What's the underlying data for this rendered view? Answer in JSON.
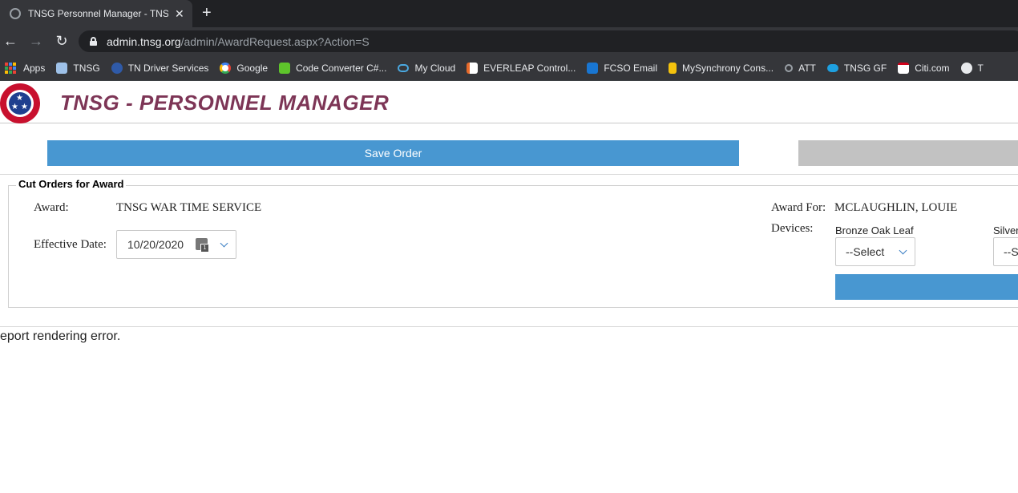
{
  "browser": {
    "tab_title": "TNSG Personnel Manager - TNSG",
    "url_host": "admin.tnsg.org",
    "url_path": "/admin/AwardRequest.aspx?Action=S",
    "bookmarks": [
      {
        "label": "Apps",
        "icon": "apps-grid-icon",
        "color": "#4285f4"
      },
      {
        "label": "TNSG",
        "icon": "page-icon",
        "color": "#9ec1e8"
      },
      {
        "label": "TN Driver Services",
        "icon": "tn-seal-icon",
        "color": "#2f5aa8"
      },
      {
        "label": "Google",
        "icon": "google-icon",
        "color": "#ffffff"
      },
      {
        "label": "Code Converter C#...",
        "icon": "code-converter-icon",
        "color": "#5ec42b"
      },
      {
        "label": "My Cloud",
        "icon": "cloud-icon",
        "color": "#4aa8e0"
      },
      {
        "label": "EVERLEAP Control...",
        "icon": "everleap-icon",
        "color": "#e86a2a"
      },
      {
        "label": "FCSO Email",
        "icon": "outlook-icon",
        "color": "#1976d2"
      },
      {
        "label": "MySynchrony Cons...",
        "icon": "synchrony-icon",
        "color": "#f4c20d"
      },
      {
        "label": "ATT",
        "icon": "key-icon",
        "color": "#9aa0a6"
      },
      {
        "label": "TNSG GF",
        "icon": "salesforce-icon",
        "color": "#1ea0e0"
      },
      {
        "label": "Citi.com",
        "icon": "citi-icon",
        "color": "#ffffff"
      },
      {
        "label": "T",
        "icon": "globe-icon",
        "color": "#e8eaed"
      }
    ]
  },
  "header": {
    "title": "TNSG - PERSONNEL MANAGER"
  },
  "actions": {
    "save_label": "Save Order"
  },
  "form": {
    "legend": "Cut Orders for Award",
    "award_label": "Award:",
    "award_value": "TNSG WAR TIME SERVICE",
    "effective_date_label": "Effective Date:",
    "effective_date_value": "10/20/2020",
    "award_for_label": "Award For:",
    "award_for_value": "MCLAUGHLIN, LOUIE",
    "devices_label": "Devices:",
    "device_1_label": "Bronze Oak Leaf",
    "device_1_value": "--Select",
    "device_2_label": "Silver",
    "device_2_value": "--S"
  },
  "report": {
    "error_text": "eport rendering error."
  }
}
